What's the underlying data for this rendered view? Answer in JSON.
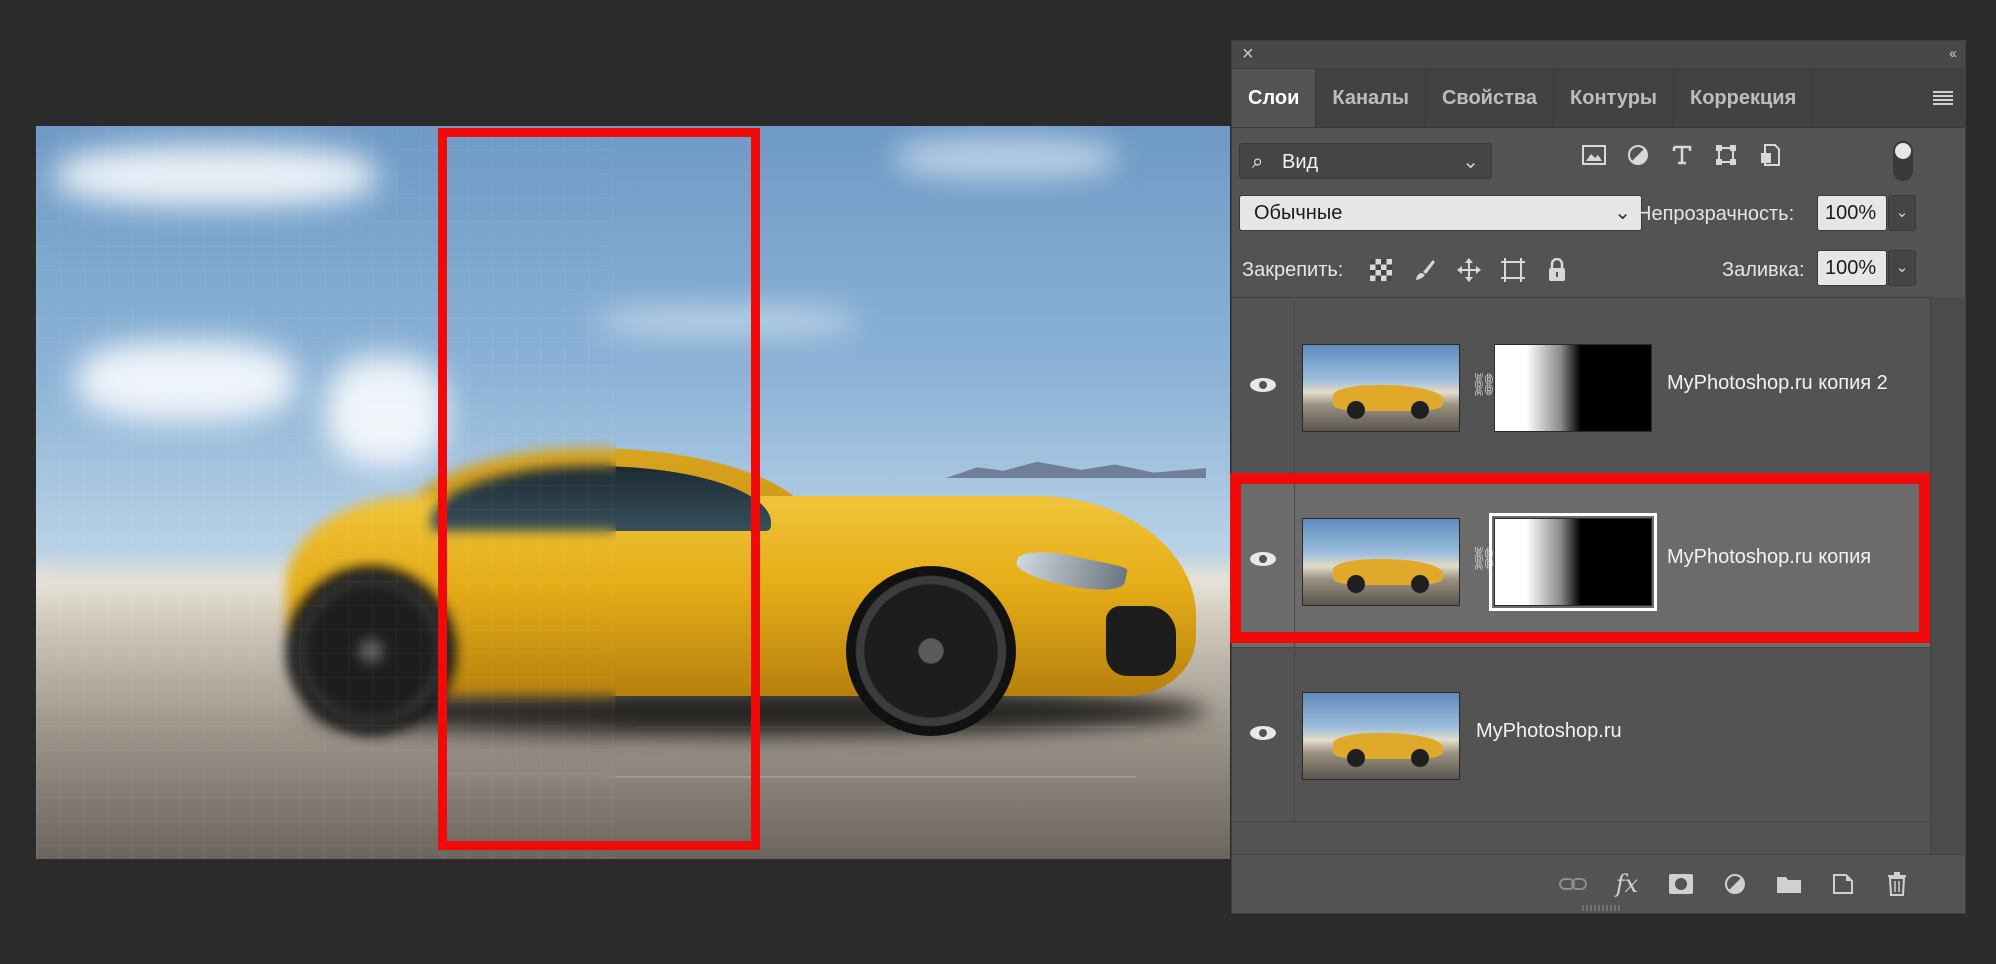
{
  "panel": {
    "close_label": "×",
    "collapse_label": "‹‹",
    "tabs": [
      "Слои",
      "Каналы",
      "Свойства",
      "Контуры",
      "Коррекция"
    ],
    "filter": {
      "label": "Вид",
      "icons": [
        "image-filter-icon",
        "adjustment-filter-icon",
        "type-filter-icon",
        "shape-filter-icon",
        "smart-object-filter-icon"
      ]
    },
    "blend_mode": "Обычные",
    "opacity_label": "Непрозрачность:",
    "opacity_value": "100%",
    "lock_label": "Закрепить:",
    "fill_label": "Заливка:",
    "fill_value": "100%",
    "layers": [
      {
        "name": "MyPhotoshop.ru копия 2",
        "visible": true,
        "has_mask": true,
        "selected": false
      },
      {
        "name": "MyPhotoshop.ru копия",
        "visible": true,
        "has_mask": true,
        "selected": true
      },
      {
        "name": "MyPhotoshop.ru",
        "visible": true,
        "has_mask": false,
        "selected": false
      }
    ],
    "bottom_icons": [
      "link-layers-icon",
      "fx-icon",
      "add-mask-icon",
      "adjustment-layer-icon",
      "new-group-icon",
      "new-layer-icon",
      "trash-icon"
    ]
  },
  "colors": {
    "annotation": "#f00a0a",
    "panel_bg": "#535353",
    "app_bg": "#2b2b2b"
  }
}
